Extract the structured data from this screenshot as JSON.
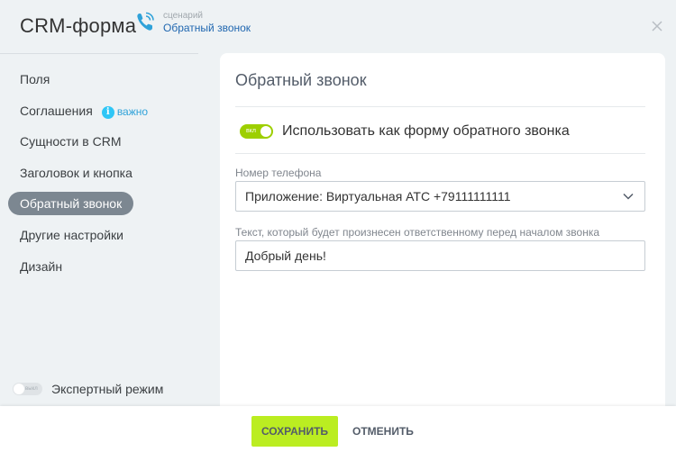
{
  "header": {
    "app_title": "CRM-форма",
    "scenario_caption": "сценарий",
    "scenario_link": "Обратный звонок",
    "icons": {
      "phone": "phone-icon",
      "close": "close-icon"
    }
  },
  "sidebar": {
    "items": [
      {
        "label": "Поля"
      },
      {
        "label": "Соглашения",
        "badge_icon": "info-icon",
        "badge_glyph": "i",
        "badge_text": "важно"
      },
      {
        "label": "Сущности в CRM"
      },
      {
        "label": "Заголовок и кнопка"
      },
      {
        "label": "Обратный звонок",
        "active": true
      },
      {
        "label": "Другие настройки"
      },
      {
        "label": "Дизайн"
      }
    ],
    "expert_mode": {
      "toggle_text": "выкл",
      "label": "Экспертный режим",
      "enabled": false
    }
  },
  "main": {
    "title": "Обратный звонок",
    "use_callback": {
      "toggle_text": "вкл",
      "label": "Использовать как форму обратного звонка",
      "enabled": true
    },
    "phone_field": {
      "label": "Номер телефона",
      "value": "Приложение: Виртуальная АТС +79111111111"
    },
    "text_field": {
      "label": "Текст, который будет произнесен ответственному перед началом звонка",
      "value": "Добрый день!"
    }
  },
  "footer": {
    "save_label": "СОХРАНИТЬ",
    "cancel_label": "ОТМЕНИТЬ"
  },
  "colors": {
    "accent_green": "#bbed21",
    "toggle_green": "#9dcf00",
    "active_nav": "#7c8791",
    "link_blue": "#2067b0",
    "info_blue": "#2fc6f6"
  }
}
